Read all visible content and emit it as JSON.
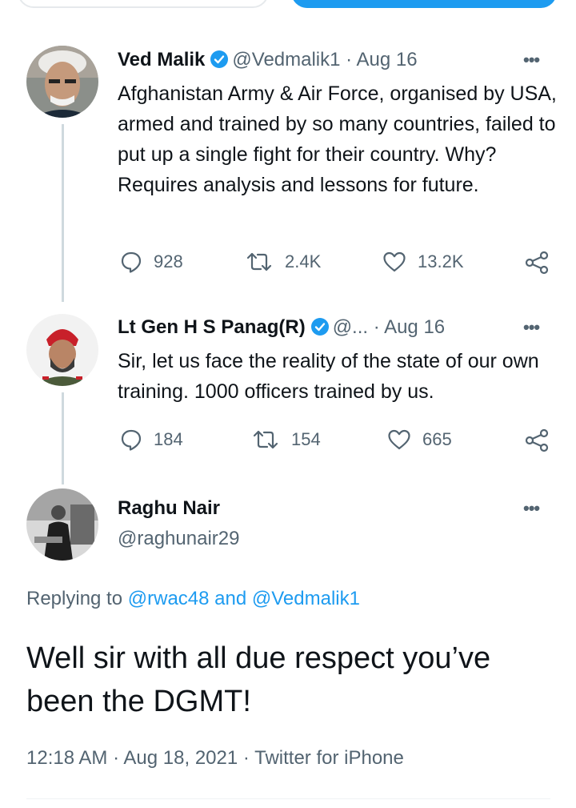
{
  "tweets": [
    {
      "name": "Ved Malik",
      "handle": "@Vedmalik1",
      "separator": "·",
      "date": "Aug 16",
      "text": "Afghanistan Army & Air Force, organised by USA, armed and trained by so many countries, failed to put up a single fight for their country. Why? Requires analysis and lessons for future.",
      "replies": "928",
      "retweets": "2.4K",
      "likes": "13.2K"
    },
    {
      "name": "Lt Gen H S Panag(R)",
      "handle": "@...",
      "separator": "·",
      "date": "Aug 16",
      "text": "Sir, let us face the reality of the state of our own training. 1000 officers trained by us.",
      "replies": "184",
      "retweets": "154",
      "likes": "665"
    }
  ],
  "focused": {
    "name": "Raghu Nair",
    "handle": "@raghunair29",
    "replying_prefix": "Replying to",
    "mention1": "@rwac48",
    "and": "and",
    "mention2": "@Vedmalik1",
    "text": "Well sir with all due respect you’ve been the DGMT!",
    "time": "12:18 AM",
    "separator": "·",
    "date": "Aug 18, 2021",
    "source": "Twitter for iPhone"
  },
  "icons": {
    "more": "more-horizontal-icon",
    "verified": "verified-badge-icon",
    "reply": "reply-icon",
    "retweet": "retweet-icon",
    "like": "heart-icon",
    "share": "share-icon"
  },
  "colors": {
    "accent": "#1d9bf0",
    "secondary_text": "#536471",
    "primary_text": "#0f1419",
    "thread_line": "#cfd9de"
  }
}
